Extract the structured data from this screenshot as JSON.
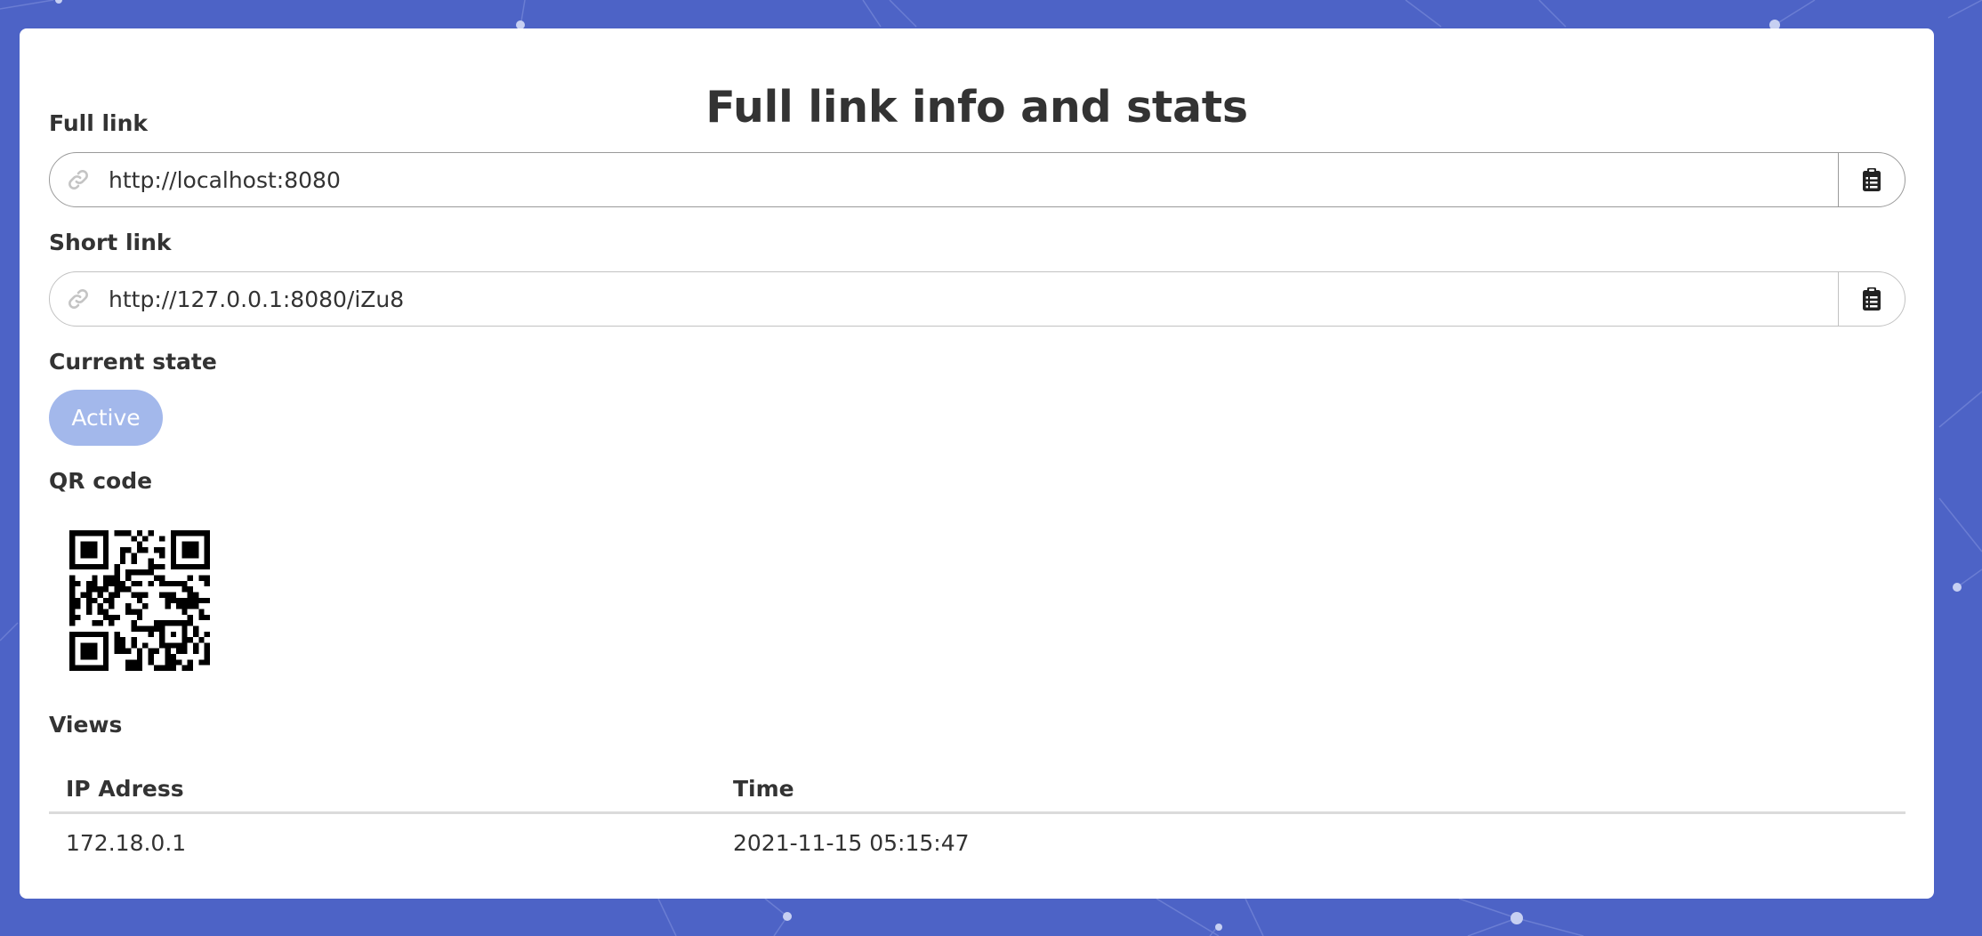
{
  "page": {
    "title": "Full link info and stats"
  },
  "full_link": {
    "label": "Full link",
    "value": "http://localhost:8080",
    "link_icon": "link-icon",
    "copy_icon": "clipboard-icon"
  },
  "short_link": {
    "label": "Short link",
    "value": "http://127.0.0.1:8080/iZu8",
    "link_icon": "link-icon",
    "copy_icon": "clipboard-icon"
  },
  "state": {
    "label": "Current state",
    "value": "Active"
  },
  "qr": {
    "label": "QR code"
  },
  "views": {
    "label": "Views",
    "columns": [
      "IP Adress",
      "Time"
    ],
    "rows": [
      [
        "172.18.0.1",
        "2021-11-15 05:15:47"
      ]
    ]
  },
  "colors": {
    "background": "#4d63c6",
    "card": "#ffffff",
    "state_pill": "#a3b8eb",
    "text": "#333333"
  }
}
